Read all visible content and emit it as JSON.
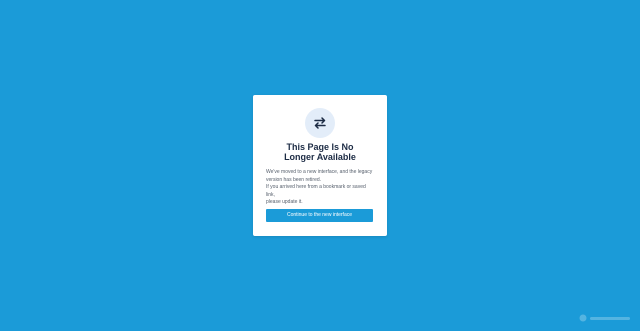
{
  "colors": {
    "background": "#1b9bd8",
    "card": "#ffffff",
    "icon_circle": "#e3edf9",
    "title": "#1c2b44",
    "text": "#555e6b",
    "button": "#1b9bd8",
    "button_text": "#ffffff"
  },
  "card": {
    "icon": "swap-arrows-icon",
    "title_line1": "This Page Is No",
    "title_line2": "Longer Available",
    "description_line1": "We've moved to a new interface, and the legacy",
    "description_line2": "version has been retired.",
    "description_line3": "If you arrived here from a bookmark or saved link,",
    "description_line4": "please update it.",
    "button_label": "Continue to the new interface"
  },
  "watermark": {
    "icon": "logo-icon"
  }
}
